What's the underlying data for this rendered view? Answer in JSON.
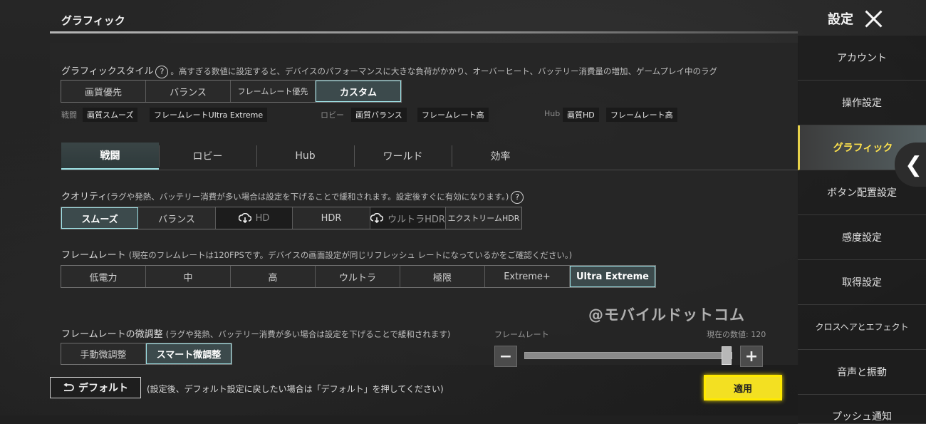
{
  "header": {
    "title": "グラフィック",
    "settings_label": "設定"
  },
  "style_section": {
    "label": "グラフィックスタイル",
    "hint": "。高すぎる数値に設定すると、デバイスのパフォーマンスに大きな負荷がかかり、オーバーヒート、バッテリー消費量の増加、ゲームプレイ中のラグ",
    "options": [
      "画質優先",
      "バランス",
      "フレームレート優先",
      "カスタム"
    ],
    "selected": "カスタム",
    "presets": {
      "battle_label": "戦闘",
      "battle_tags": [
        "画質スムーズ",
        "フレームレートUltra Extreme"
      ],
      "lobby_label": "ロビー",
      "lobby_tags": [
        "画質バランス",
        "フレームレート高"
      ],
      "hub_label": "Hub",
      "hub_tags": [
        "画質HD",
        "フレームレート高"
      ]
    }
  },
  "tabs": [
    "戦闘",
    "ロビー",
    "Hub",
    "ワールド",
    "効率"
  ],
  "active_tab": "戦闘",
  "quality": {
    "label": "クオリティ",
    "hint": "(ラグや発熱、バッテリー消費が多い場合は設定を下げることで緩和されます。設定後すぐに有効になります。)",
    "options": [
      "スムーズ",
      "バランス",
      "HD",
      "HDR",
      "ウルトラHDR",
      "エクストリームHDR"
    ],
    "selected": "スムーズ"
  },
  "framerate": {
    "label": "フレームレート",
    "hint": "(現在のフレムレートは120FPSです。デバイスの画面設定が同じリフレッシュ レートになっているかをご確認ください。)",
    "options": [
      "低電力",
      "中",
      "高",
      "ウルトラ",
      "極限",
      "Extreme+",
      "Ultra Extreme"
    ],
    "selected": "Ultra Extreme"
  },
  "fine_tune": {
    "label": "フレームレートの微調整",
    "hint": "(ラグや発熱、バッテリー消費が多い場合は設定を下げることで緩和されます)",
    "options": [
      "手動微調整",
      "スマート微調整"
    ],
    "selected": "スマート微調整",
    "slider_label": "フレームレート",
    "current_value": "現在の数値: 120",
    "slider_level": 1.0
  },
  "watermark": "@モバイルドットコム",
  "sidebar": {
    "items": [
      "アカウント",
      "操作設定",
      "グラフィック",
      "ボタン配置設定",
      "感度設定",
      "取得設定",
      "クロスヘアとエフェクト",
      "音声と振動",
      "プッシュ通知"
    ],
    "active": "グラフィック"
  },
  "bottom": {
    "default_label": "デフォルト",
    "note": "(設定後、デフォルト設定に戻したい場合は「デフォルト」を押してください)",
    "apply_label": "適用"
  },
  "colors": {
    "accent": "#9fe3e7",
    "apply": "#f3e022",
    "active_sidebar_text": "#ffe34d"
  }
}
